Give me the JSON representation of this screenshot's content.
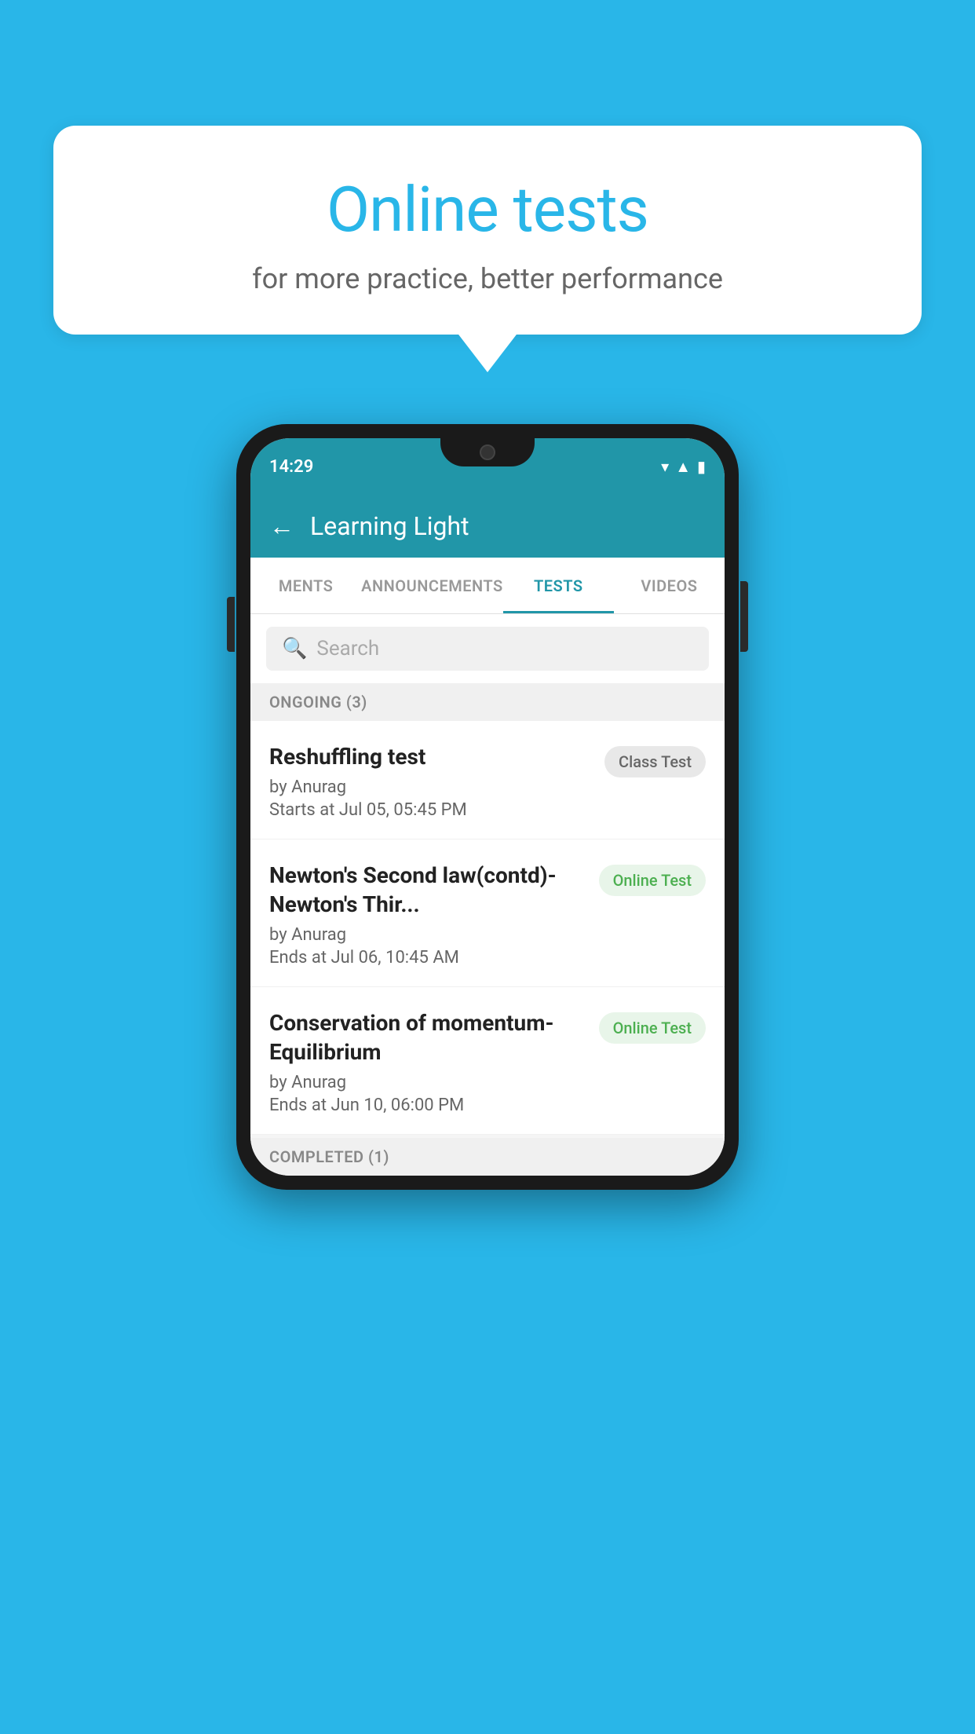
{
  "background_color": "#29b6e8",
  "speech_bubble": {
    "title": "Online tests",
    "subtitle": "for more practice, better performance"
  },
  "phone": {
    "status_bar": {
      "time": "14:29",
      "icons": [
        "wifi",
        "signal",
        "battery"
      ]
    },
    "app_header": {
      "back_label": "←",
      "title": "Learning Light"
    },
    "tabs": [
      {
        "label": "MENTS",
        "active": false
      },
      {
        "label": "ANNOUNCEMENTS",
        "active": false
      },
      {
        "label": "TESTS",
        "active": true
      },
      {
        "label": "VIDEOS",
        "active": false
      }
    ],
    "search": {
      "placeholder": "Search"
    },
    "sections": [
      {
        "label": "ONGOING (3)",
        "tests": [
          {
            "name": "Reshuffling test",
            "author": "by Anurag",
            "time_label": "Starts at  Jul 05, 05:45 PM",
            "badge": "Class Test",
            "badge_type": "class"
          },
          {
            "name": "Newton's Second law(contd)-Newton's Thir...",
            "author": "by Anurag",
            "time_label": "Ends at  Jul 06, 10:45 AM",
            "badge": "Online Test",
            "badge_type": "online"
          },
          {
            "name": "Conservation of momentum-Equilibrium",
            "author": "by Anurag",
            "time_label": "Ends at  Jun 10, 06:00 PM",
            "badge": "Online Test",
            "badge_type": "online"
          }
        ]
      }
    ],
    "completed_label": "COMPLETED (1)"
  }
}
